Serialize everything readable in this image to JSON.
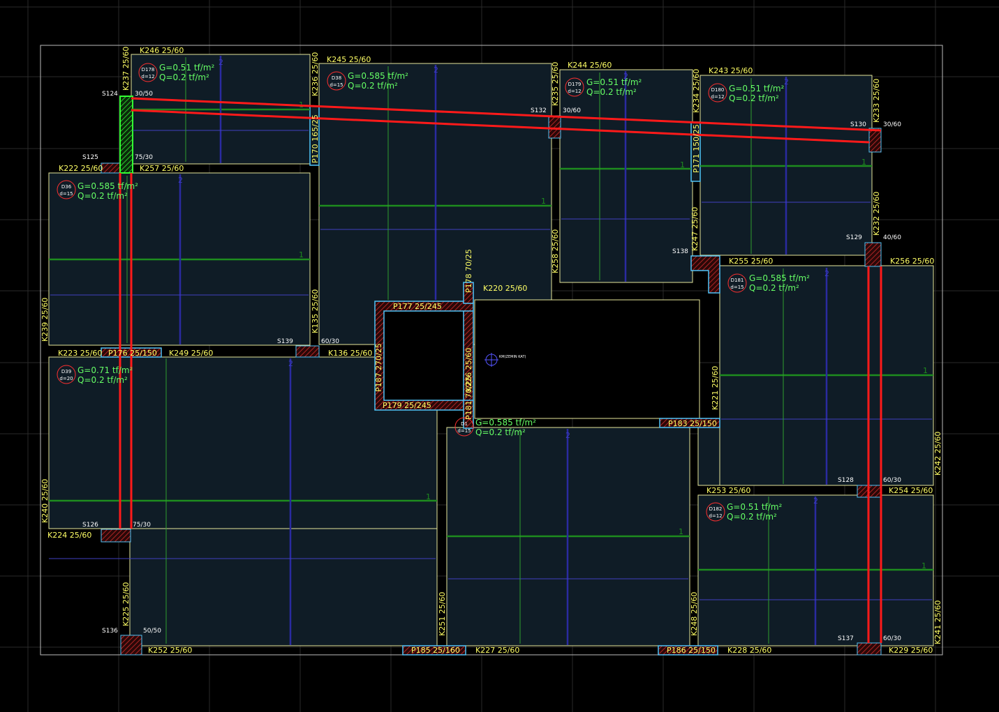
{
  "colors": {
    "background": "#000000",
    "grid": "#2a2a2a",
    "slab_fill": "#0f1c26",
    "beam_line": "#e6e69a",
    "beam_label": "#ffff66",
    "column_label": "#ffffff",
    "load_text": "#66ff66",
    "direction_1": "#1e8c1e",
    "direction_2": "#2a2aa0",
    "span_arrow": "#4040c0",
    "section_line": "#ff1a1a",
    "selection": "#33ff33",
    "column_hatch": "#a02020",
    "column_outline": "#4fc3f7",
    "slab_id_circle": "#ff3030"
  },
  "beams": [
    {
      "id": "k246",
      "label": "K246 25/60"
    },
    {
      "id": "k245",
      "label": "K245 25/60"
    },
    {
      "id": "k244",
      "label": "K244 25/60"
    },
    {
      "id": "k243",
      "label": "K243 25/60"
    },
    {
      "id": "k237",
      "label": "K237 25/60"
    },
    {
      "id": "k236",
      "label": "K236 25/60"
    },
    {
      "id": "k235",
      "label": "K235 25/60"
    },
    {
      "id": "k234",
      "label": "K234 25/60"
    },
    {
      "id": "k233",
      "label": "K233 25/60"
    },
    {
      "id": "k222",
      "label": "K222 25/60"
    },
    {
      "id": "k257",
      "label": "K257 25/60"
    },
    {
      "id": "p170",
      "label": "P170 165/25"
    },
    {
      "id": "p171",
      "label": "P171 150/25"
    },
    {
      "id": "k232",
      "label": "K232 25/60"
    },
    {
      "id": "k247",
      "label": "K247 25/60"
    },
    {
      "id": "k258",
      "label": "K258 25/60"
    },
    {
      "id": "k255",
      "label": "K255 25/60"
    },
    {
      "id": "k256",
      "label": "K256 25/60"
    },
    {
      "id": "p178",
      "label": "P178 70/25"
    },
    {
      "id": "k220",
      "label": "K220 25/60"
    },
    {
      "id": "p177",
      "label": "P177 25/245"
    },
    {
      "id": "k239",
      "label": "K239 25/60"
    },
    {
      "id": "k135",
      "label": "K135 25/60"
    },
    {
      "id": "k223",
      "label": "K223 25/60"
    },
    {
      "id": "p176",
      "label": "P176 25/150"
    },
    {
      "id": "k249",
      "label": "K249 25/60"
    },
    {
      "id": "k136",
      "label": "K136 25/60"
    },
    {
      "id": "p187",
      "label": "P187 270/25"
    },
    {
      "id": "k226",
      "label": "K226 25/60"
    },
    {
      "id": "p179",
      "label": "P179 25/245"
    },
    {
      "id": "p181",
      "label": "P181 70/25"
    },
    {
      "id": "k221",
      "label": "K221 25/60"
    },
    {
      "id": "p183",
      "label": "P183 25/150"
    },
    {
      "id": "k242",
      "label": "K242 25/60"
    },
    {
      "id": "k253",
      "label": "K253 25/60"
    },
    {
      "id": "k254",
      "label": "K254 25/60"
    },
    {
      "id": "k240",
      "label": "K240 25/60"
    },
    {
      "id": "k224",
      "label": "K224 25/60"
    },
    {
      "id": "k225",
      "label": "K225 25/60"
    },
    {
      "id": "k251",
      "label": "K251 25/60"
    },
    {
      "id": "k248",
      "label": "K248 25/60"
    },
    {
      "id": "k241",
      "label": "K241 25/60"
    },
    {
      "id": "k252",
      "label": "K252 25/60"
    },
    {
      "id": "p185",
      "label": "P185 25/160"
    },
    {
      "id": "k227",
      "label": "K227 25/60"
    },
    {
      "id": "p186",
      "label": "P186 25/150"
    },
    {
      "id": "k228",
      "label": "K228 25/60"
    },
    {
      "id": "k229",
      "label": "K229 25/60"
    }
  ],
  "columns": [
    {
      "id": "s124",
      "name": "S124",
      "size": "30/50"
    },
    {
      "id": "s125",
      "name": "S125",
      "size": "75/30"
    },
    {
      "id": "s132",
      "name": "S132",
      "size": "30/60"
    },
    {
      "id": "s130",
      "name": "S130",
      "size": "30/60"
    },
    {
      "id": "s129",
      "name": "S129",
      "size": "40/60"
    },
    {
      "id": "s138",
      "name": "S138",
      "size": ""
    },
    {
      "id": "s139",
      "name": "S139",
      "size": "60/30"
    },
    {
      "id": "s128",
      "name": "S128",
      "size": "60/30"
    },
    {
      "id": "s126",
      "name": "S126",
      "size": "75/30"
    },
    {
      "id": "s136",
      "name": "S136",
      "size": "50/50"
    },
    {
      "id": "s137",
      "name": "S137",
      "size": "60/30"
    }
  ],
  "slabs": [
    {
      "id": "d178",
      "name": "D178",
      "thickness": "d=12",
      "g": "G=0.51 tf/m²",
      "q": "Q=0.2 tf/m²"
    },
    {
      "id": "d38",
      "name": "D38",
      "thickness": "d=15",
      "g": "G=0.585 tf/m²",
      "q": "Q=0.2 tf/m²"
    },
    {
      "id": "d179",
      "name": "D179",
      "thickness": "d=12",
      "g": "G=0.51 tf/m²",
      "q": "Q=0.2 tf/m²"
    },
    {
      "id": "d180",
      "name": "D180",
      "thickness": "d=12",
      "g": "G=0.51 tf/m²",
      "q": "Q=0.2 tf/m²"
    },
    {
      "id": "d36",
      "name": "D36",
      "thickness": "d=15",
      "g": "G=0.585 tf/m²",
      "q": "Q=0.2 tf/m²"
    },
    {
      "id": "d181",
      "name": "D181",
      "thickness": "d=15",
      "g": "G=0.585 tf/m²",
      "q": "Q=0.2 tf/m²"
    },
    {
      "id": "d39",
      "name": "D39",
      "thickness": "d=20",
      "g": "G=0.71 tf/m²",
      "q": "Q=0.2 tf/m²"
    },
    {
      "id": "d1x",
      "name": "D1",
      "thickness": "d=15",
      "g": "G=0.585 tf/m²",
      "q": "Q=0.2 tf/m²"
    },
    {
      "id": "d182",
      "name": "D182",
      "thickness": "d=12",
      "g": "G=0.51 tf/m²",
      "q": "Q=0.2 tf/m²"
    }
  ],
  "direction_labels": {
    "one": "1",
    "two": "2"
  },
  "origin_marker": {
    "label": "KM(ZEMIN KAT)"
  }
}
